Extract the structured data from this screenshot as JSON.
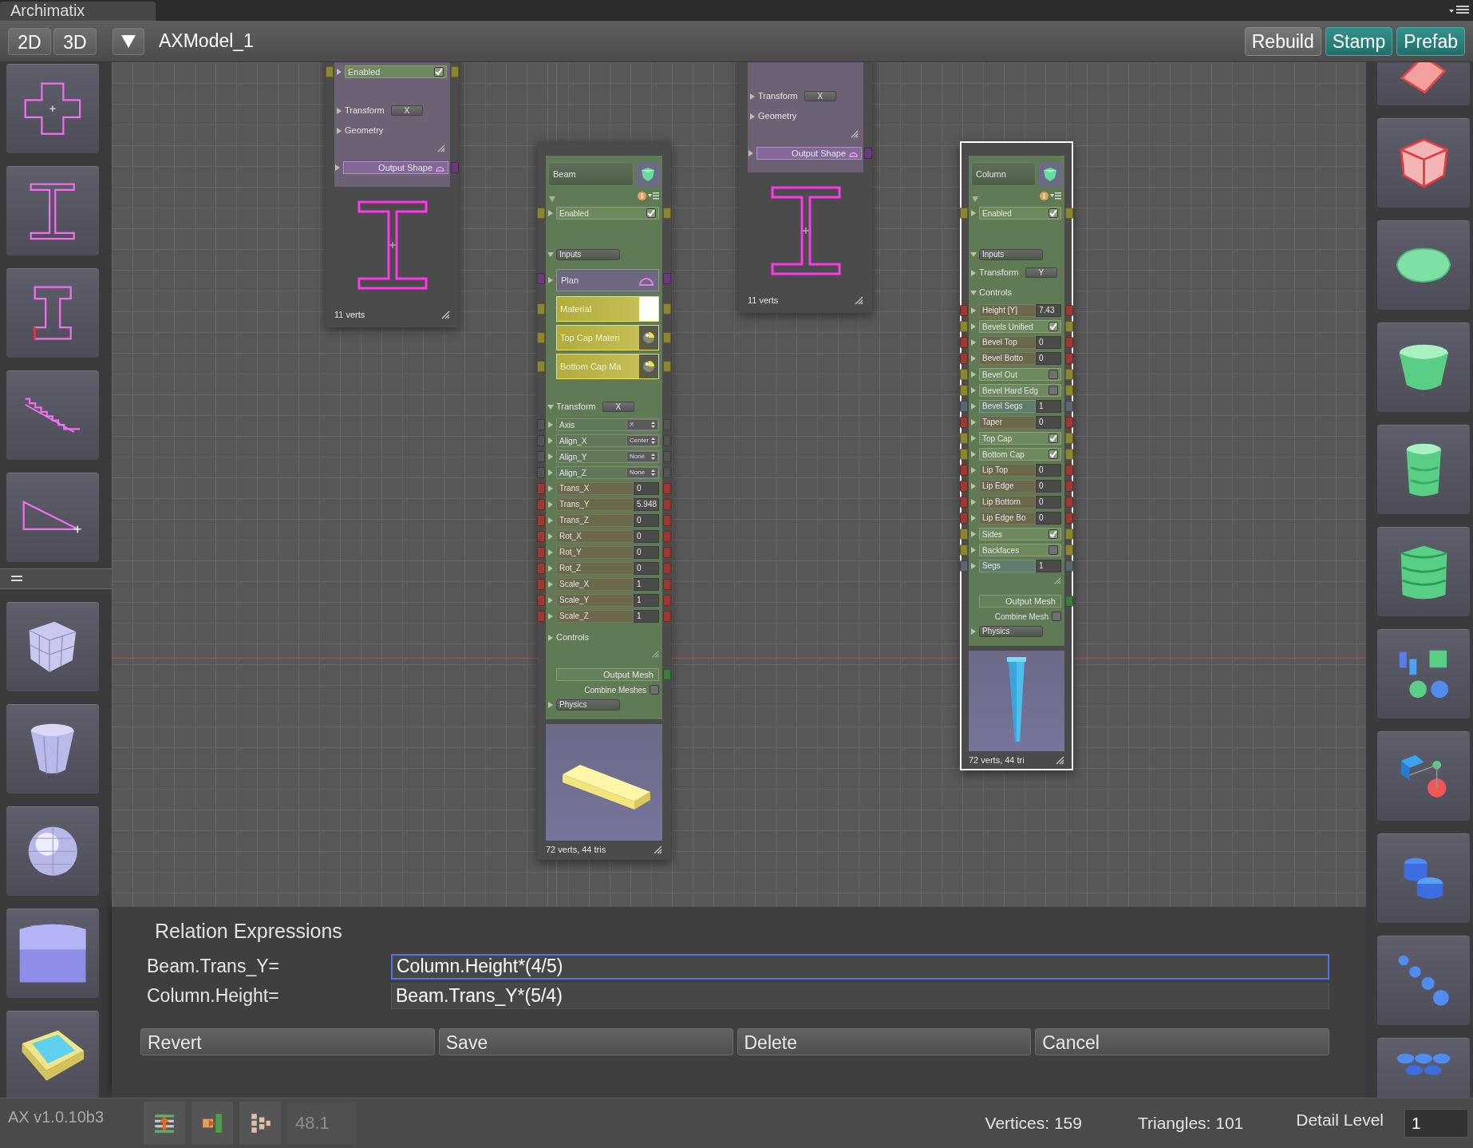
{
  "window": {
    "title": "Archimatix"
  },
  "toolbar": {
    "view_buttons": [
      {
        "label": "2D"
      },
      {
        "label": "3D"
      }
    ],
    "model_name": "AXModel_1",
    "actions": [
      {
        "label": "Rebuild",
        "kind": "plain"
      },
      {
        "label": "Stamp",
        "kind": "accent"
      },
      {
        "label": "Prefab",
        "kind": "accent"
      }
    ]
  },
  "nodes": [
    {
      "kind": "shape",
      "selected": false,
      "rows": [
        {
          "kind": "check",
          "label": "Enabled",
          "checked": true
        },
        {
          "kind": "section",
          "label": "Transform",
          "expanded": false,
          "button": "X"
        },
        {
          "kind": "section",
          "label": "Geometry",
          "expanded": false
        }
      ],
      "output": "Output Shape",
      "footer": "11 verts"
    },
    {
      "kind": "mesh",
      "name": "Beam",
      "selected": false,
      "rows": [
        {
          "kind": "check",
          "label": "Enabled",
          "checked": true
        },
        {
          "kind": "group",
          "label": "Inputs",
          "expanded": true
        },
        {
          "kind": "shape_input",
          "label": "Plan"
        },
        {
          "kind": "material",
          "label": "Material",
          "assigned": false
        },
        {
          "kind": "material",
          "label": "Top Cap Materi",
          "assigned": true
        },
        {
          "kind": "material",
          "label": "Bottom Cap Ma",
          "assigned": true
        },
        {
          "kind": "section",
          "label": "Transform",
          "expanded": true,
          "button": "X"
        },
        {
          "kind": "select",
          "label": "Axis",
          "value": "X"
        },
        {
          "kind": "select",
          "label": "Align_X",
          "value": "Center"
        },
        {
          "kind": "select",
          "label": "Align_Y",
          "value": "None"
        },
        {
          "kind": "select",
          "label": "Align_Z",
          "value": "None"
        },
        {
          "kind": "number",
          "label": "Trans_X",
          "value": "0"
        },
        {
          "kind": "number",
          "label": "Trans_Y",
          "value": "5.948"
        },
        {
          "kind": "number",
          "label": "Trans_Z",
          "value": "0"
        },
        {
          "kind": "number",
          "label": "Rot_X",
          "value": "0"
        },
        {
          "kind": "number",
          "label": "Rot_Y",
          "value": "0"
        },
        {
          "kind": "number",
          "label": "Rot_Z",
          "value": "0"
        },
        {
          "kind": "number",
          "label": "Scale_X",
          "value": "1"
        },
        {
          "kind": "number",
          "label": "Scale_Y",
          "value": "1"
        },
        {
          "kind": "number",
          "label": "Scale_Z",
          "value": "1"
        },
        {
          "kind": "section",
          "label": "Controls",
          "expanded": false
        },
        {
          "kind": "output",
          "label": "Output Mesh"
        },
        {
          "kind": "toggle",
          "label": "Combine Meshes",
          "checked": false
        },
        {
          "kind": "group",
          "label": "Physics",
          "expanded": false
        }
      ],
      "footer": "72 verts, 44 tris"
    },
    {
      "kind": "shape",
      "selected": false,
      "rows": [
        {
          "kind": "section",
          "label": "Transform",
          "expanded": false,
          "button": "X"
        },
        {
          "kind": "section",
          "label": "Geometry",
          "expanded": false
        }
      ],
      "output": "Output Shape",
      "footer": "11 verts"
    },
    {
      "kind": "mesh",
      "name": "Column",
      "selected": true,
      "rows": [
        {
          "kind": "check",
          "label": "Enabled",
          "checked": true
        },
        {
          "kind": "group",
          "label": "Inputs",
          "expanded": true
        },
        {
          "kind": "section",
          "label": "Transform",
          "expanded": false,
          "button": "Y"
        },
        {
          "kind": "section",
          "label": "Controls",
          "expanded": true
        },
        {
          "kind": "number",
          "label": "Height [Y]",
          "value": "7.43"
        },
        {
          "kind": "check",
          "label": "Bevels Unified",
          "checked": true
        },
        {
          "kind": "number",
          "label": "Bevel Top",
          "value": "0"
        },
        {
          "kind": "number",
          "label": "Bevel Botto",
          "value": "0"
        },
        {
          "kind": "check",
          "label": "Bevel Out",
          "checked": false
        },
        {
          "kind": "check",
          "label": "Bevel Hard Edg",
          "checked": false
        },
        {
          "kind": "integer",
          "label": "Bevel Segs",
          "value": "1"
        },
        {
          "kind": "number",
          "label": "Taper",
          "value": "0"
        },
        {
          "kind": "check",
          "label": "Top Cap",
          "checked": true
        },
        {
          "kind": "check",
          "label": "Bottom Cap",
          "checked": true
        },
        {
          "kind": "number",
          "label": "Lip Top",
          "value": "0"
        },
        {
          "kind": "number",
          "label": "Lip Edge",
          "value": "0"
        },
        {
          "kind": "number",
          "label": "Lip Bottom",
          "value": "0"
        },
        {
          "kind": "number",
          "label": "Lip Edge Bo",
          "value": "0"
        },
        {
          "kind": "check",
          "label": "Sides",
          "checked": true
        },
        {
          "kind": "check",
          "label": "Backfaces",
          "checked": false
        },
        {
          "kind": "integer",
          "label": "Segs",
          "value": "1"
        },
        {
          "kind": "output",
          "label": "Output Mesh"
        },
        {
          "kind": "toggle",
          "label": "Combine Mesh",
          "checked": false
        },
        {
          "kind": "group",
          "label": "Physics",
          "expanded": false
        }
      ],
      "footer": "72 verts, 44 tri"
    }
  ],
  "relations": {
    "title": "Relation Expressions",
    "expressions": [
      {
        "label": "Beam.Trans_Y=",
        "value": "Column.Height*(4/5)",
        "focused": true
      },
      {
        "label": "Column.Height=",
        "value": "Beam.Trans_Y*(5/4)",
        "focused": false
      }
    ],
    "buttons": [
      "Revert",
      "Save",
      "Delete",
      "Cancel"
    ]
  },
  "status_bar": {
    "version": "AX v1.0.10b3",
    "fps": "48.1",
    "vertices": "Vertices: 159",
    "triangles": "Triangles: 101",
    "detail_label": "Detail Level",
    "detail_value": "1"
  }
}
